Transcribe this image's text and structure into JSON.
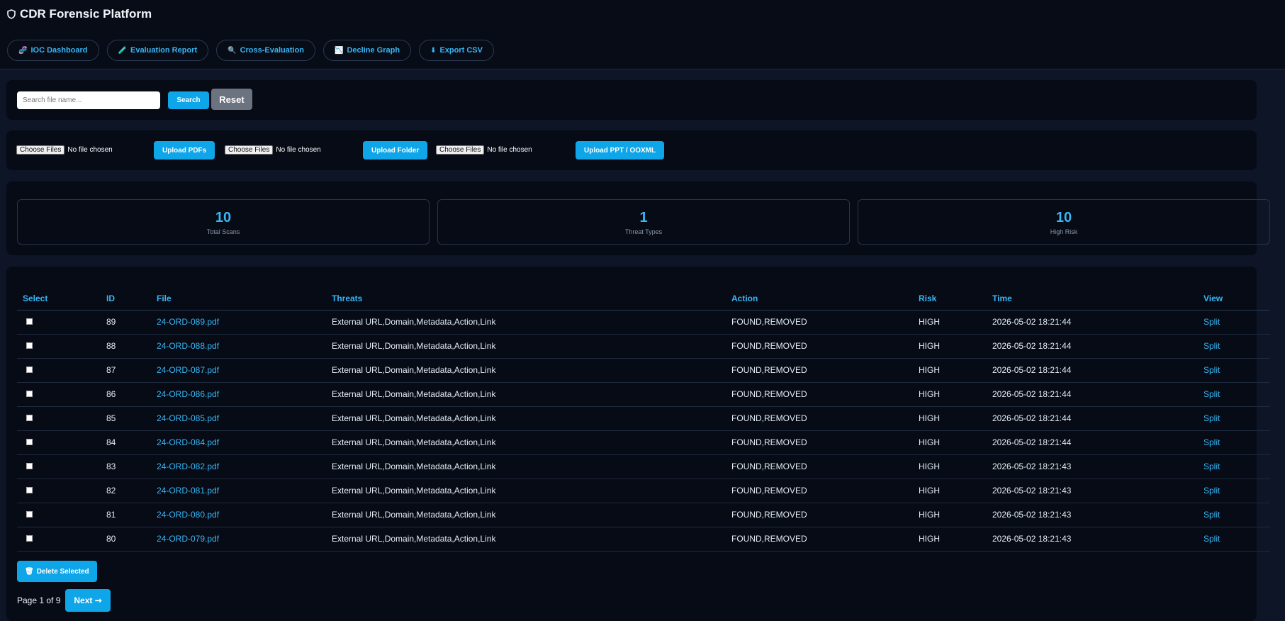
{
  "app": {
    "title": "CDR Forensic Platform",
    "icon": "shield-icon"
  },
  "nav": [
    {
      "label": "IOC Dashboard",
      "icon": "🧬"
    },
    {
      "label": "Evaluation Report",
      "icon": "🧪"
    },
    {
      "label": "Cross-Evaluation",
      "icon": "🔍"
    },
    {
      "label": "Decline Graph",
      "icon": "📉"
    },
    {
      "label": "Export CSV",
      "icon": "⬇"
    }
  ],
  "search": {
    "placeholder": "Search file name...",
    "value": "",
    "search_label": "Search",
    "reset_label": "Reset"
  },
  "uploads": [
    {
      "choose_label": "Choose Files",
      "status": "No file chosen",
      "button": "Upload PDFs"
    },
    {
      "choose_label": "Choose Files",
      "status": "No file chosen",
      "button": "Upload Folder"
    },
    {
      "choose_label": "Choose Files",
      "status": "No file chosen",
      "button": "Upload PPT / OOXML"
    }
  ],
  "stats": [
    {
      "value": "10",
      "label": "Total Scans"
    },
    {
      "value": "1",
      "label": "Threat Types"
    },
    {
      "value": "10",
      "label": "High Risk"
    }
  ],
  "table": {
    "headers": [
      "Select",
      "ID",
      "File",
      "Threats",
      "Action",
      "Risk",
      "Time",
      "View"
    ],
    "rows": [
      {
        "id": "89",
        "file": "24-ORD-089.pdf",
        "threats": "External URL,Domain,Metadata,Action,Link",
        "action": "FOUND,REMOVED",
        "risk": "HIGH",
        "time": "2026-05-02 18:21:44",
        "view": "Split"
      },
      {
        "id": "88",
        "file": "24-ORD-088.pdf",
        "threats": "External URL,Domain,Metadata,Action,Link",
        "action": "FOUND,REMOVED",
        "risk": "HIGH",
        "time": "2026-05-02 18:21:44",
        "view": "Split"
      },
      {
        "id": "87",
        "file": "24-ORD-087.pdf",
        "threats": "External URL,Domain,Metadata,Action,Link",
        "action": "FOUND,REMOVED",
        "risk": "HIGH",
        "time": "2026-05-02 18:21:44",
        "view": "Split"
      },
      {
        "id": "86",
        "file": "24-ORD-086.pdf",
        "threats": "External URL,Domain,Metadata,Action,Link",
        "action": "FOUND,REMOVED",
        "risk": "HIGH",
        "time": "2026-05-02 18:21:44",
        "view": "Split"
      },
      {
        "id": "85",
        "file": "24-ORD-085.pdf",
        "threats": "External URL,Domain,Metadata,Action,Link",
        "action": "FOUND,REMOVED",
        "risk": "HIGH",
        "time": "2026-05-02 18:21:44",
        "view": "Split"
      },
      {
        "id": "84",
        "file": "24-ORD-084.pdf",
        "threats": "External URL,Domain,Metadata,Action,Link",
        "action": "FOUND,REMOVED",
        "risk": "HIGH",
        "time": "2026-05-02 18:21:44",
        "view": "Split"
      },
      {
        "id": "83",
        "file": "24-ORD-082.pdf",
        "threats": "External URL,Domain,Metadata,Action,Link",
        "action": "FOUND,REMOVED",
        "risk": "HIGH",
        "time": "2026-05-02 18:21:43",
        "view": "Split"
      },
      {
        "id": "82",
        "file": "24-ORD-081.pdf",
        "threats": "External URL,Domain,Metadata,Action,Link",
        "action": "FOUND,REMOVED",
        "risk": "HIGH",
        "time": "2026-05-02 18:21:43",
        "view": "Split"
      },
      {
        "id": "81",
        "file": "24-ORD-080.pdf",
        "threats": "External URL,Domain,Metadata,Action,Link",
        "action": "FOUND,REMOVED",
        "risk": "HIGH",
        "time": "2026-05-02 18:21:43",
        "view": "Split"
      },
      {
        "id": "80",
        "file": "24-ORD-079.pdf",
        "threats": "External URL,Domain,Metadata,Action,Link",
        "action": "FOUND,REMOVED",
        "risk": "HIGH",
        "time": "2026-05-02 18:21:43",
        "view": "Split"
      }
    ]
  },
  "actions": {
    "delete_label": "Delete Selected",
    "delete_icon": "🗑"
  },
  "pagination": {
    "text": "Page 1 of 9",
    "next_label": "Next ➞"
  },
  "colors": {
    "accent": "#0ea5e9",
    "background": "#0d1526",
    "panel": "#060b16"
  }
}
